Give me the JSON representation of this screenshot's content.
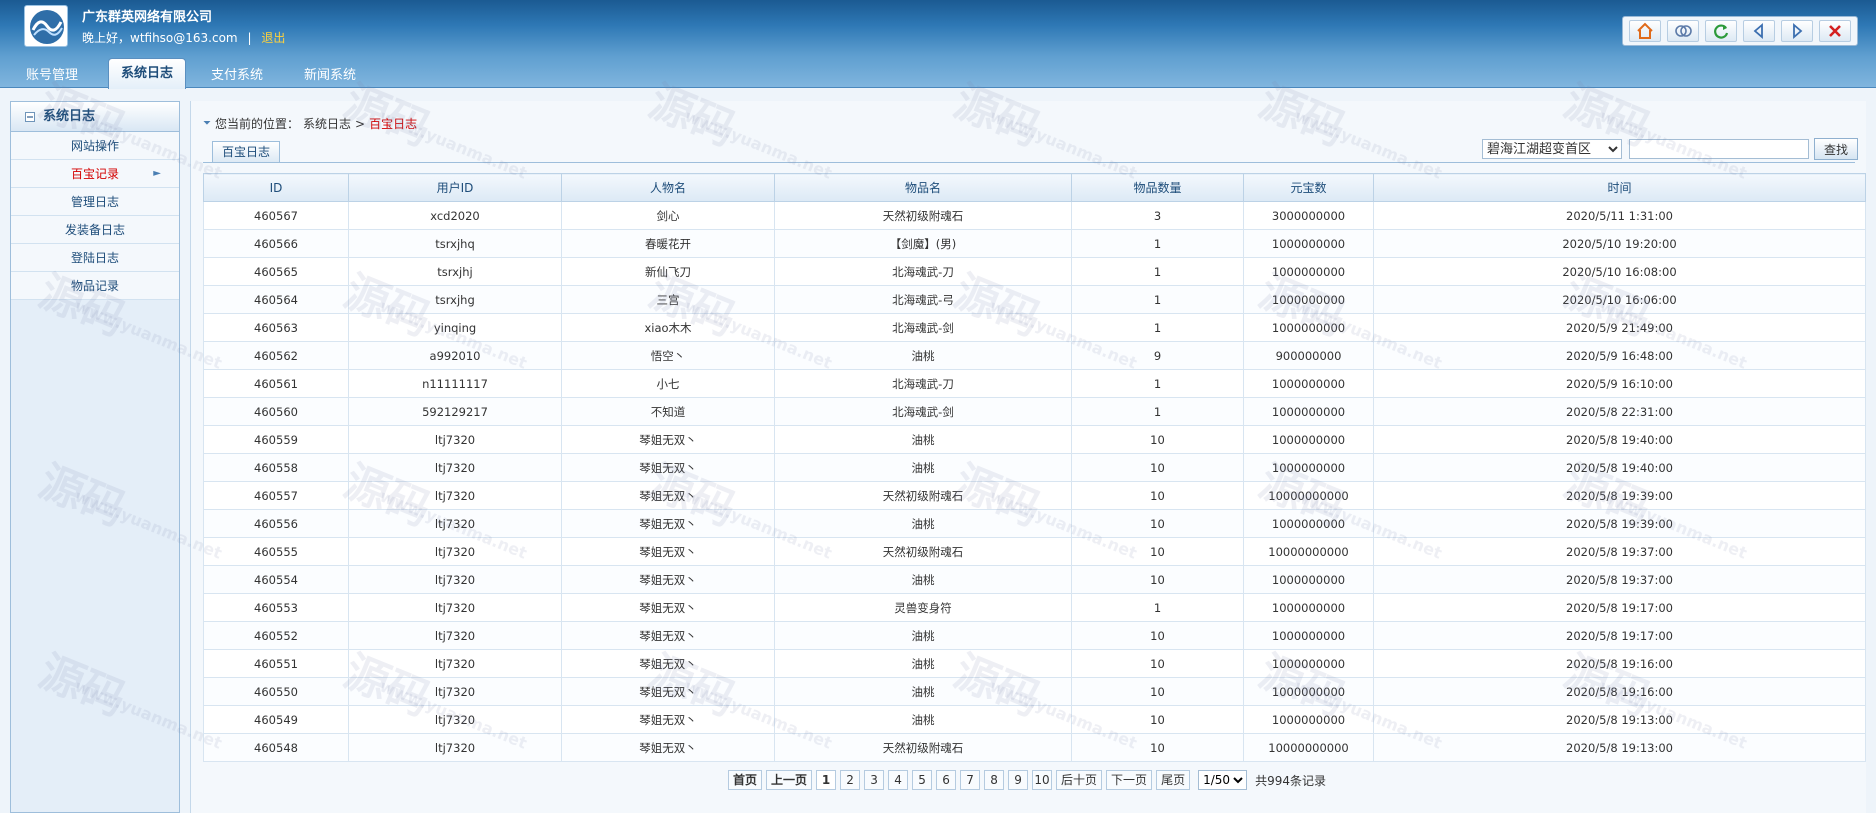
{
  "header": {
    "company": "广东群英网络有限公司",
    "greeting": "晚上好，wtfihso@163.com",
    "separator": "|",
    "logout": "退出"
  },
  "toolbar": [
    {
      "name": "home-icon",
      "color": "#e06a1a"
    },
    {
      "name": "refresh-window-icon",
      "color": "#5c7aa8"
    },
    {
      "name": "reload-icon",
      "color": "#2c9a3a"
    },
    {
      "name": "back-icon",
      "color": "#3c6fb0"
    },
    {
      "name": "forward-icon",
      "color": "#3c6fb0"
    },
    {
      "name": "close-icon",
      "color": "#d42020"
    }
  ],
  "tabs": [
    "账号管理",
    "系统日志",
    "支付系统",
    "新闻系统"
  ],
  "sidebar": {
    "title": "系统日志",
    "items": [
      "网站操作",
      "百宝记录",
      "管理日志",
      "发装备日志",
      "登陆日志",
      "物品记录"
    ]
  },
  "breadcrumb": {
    "prefix": "您当前的位置：",
    "section": "系统日志",
    "arrow": ">",
    "current": "百宝日志"
  },
  "subtab": "百宝日志",
  "filter": {
    "server": "碧海江湖超变首区",
    "search_button": "查找"
  },
  "table": {
    "headers": [
      "ID",
      "用户ID",
      "人物名",
      "物品名",
      "物品数量",
      "元宝数",
      "时间"
    ],
    "rows": [
      [
        "460567",
        "xcd2020",
        "剑心",
        "天然初级附魂石",
        "3",
        "3000000000",
        "2020/5/11 1:31:00"
      ],
      [
        "460566",
        "tsrxjhq",
        "春暖花开",
        "【剑魔】(男)",
        "1",
        "1000000000",
        "2020/5/10 19:20:00"
      ],
      [
        "460565",
        "tsrxjhj",
        "新仙飞刀",
        "北海魂武-刀",
        "1",
        "1000000000",
        "2020/5/10 16:08:00"
      ],
      [
        "460564",
        "tsrxjhg",
        "三宫",
        "北海魂武-弓",
        "1",
        "1000000000",
        "2020/5/10 16:06:00"
      ],
      [
        "460563",
        "yinqing",
        "xiao木木",
        "北海魂武-剑",
        "1",
        "1000000000",
        "2020/5/9 21:49:00"
      ],
      [
        "460562",
        "a992010",
        "悟空丶",
        "油桃",
        "9",
        "900000000",
        "2020/5/9 16:48:00"
      ],
      [
        "460561",
        "n11111117",
        "小七",
        "北海魂武-刀",
        "1",
        "1000000000",
        "2020/5/9 16:10:00"
      ],
      [
        "460560",
        "592129217",
        "不知道",
        "北海魂武-剑",
        "1",
        "1000000000",
        "2020/5/8 22:31:00"
      ],
      [
        "460559",
        "ltj7320",
        "琴姐无双丶",
        "油桃",
        "10",
        "1000000000",
        "2020/5/8 19:40:00"
      ],
      [
        "460558",
        "ltj7320",
        "琴姐无双丶",
        "油桃",
        "10",
        "1000000000",
        "2020/5/8 19:40:00"
      ],
      [
        "460557",
        "ltj7320",
        "琴姐无双丶",
        "天然初级附魂石",
        "10",
        "10000000000",
        "2020/5/8 19:39:00"
      ],
      [
        "460556",
        "ltj7320",
        "琴姐无双丶",
        "油桃",
        "10",
        "1000000000",
        "2020/5/8 19:39:00"
      ],
      [
        "460555",
        "ltj7320",
        "琴姐无双丶",
        "天然初级附魂石",
        "10",
        "10000000000",
        "2020/5/8 19:37:00"
      ],
      [
        "460554",
        "ltj7320",
        "琴姐无双丶",
        "油桃",
        "10",
        "1000000000",
        "2020/5/8 19:37:00"
      ],
      [
        "460553",
        "ltj7320",
        "琴姐无双丶",
        "灵兽变身符",
        "1",
        "1000000000",
        "2020/5/8 19:17:00"
      ],
      [
        "460552",
        "ltj7320",
        "琴姐无双丶",
        "油桃",
        "10",
        "1000000000",
        "2020/5/8 19:17:00"
      ],
      [
        "460551",
        "ltj7320",
        "琴姐无双丶",
        "油桃",
        "10",
        "1000000000",
        "2020/5/8 19:16:00"
      ],
      [
        "460550",
        "ltj7320",
        "琴姐无双丶",
        "油桃",
        "10",
        "1000000000",
        "2020/5/8 19:16:00"
      ],
      [
        "460549",
        "ltj7320",
        "琴姐无双丶",
        "油桃",
        "10",
        "1000000000",
        "2020/5/8 19:13:00"
      ],
      [
        "460548",
        "ltj7320",
        "琴姐无双丶",
        "天然初级附魂石",
        "10",
        "10000000000",
        "2020/5/8 19:13:00"
      ]
    ]
  },
  "pager": {
    "first": "首页",
    "prev": "上一页",
    "pages": [
      "1",
      "2",
      "3",
      "4",
      "5",
      "6",
      "7",
      "8",
      "9",
      "10"
    ],
    "current": "1",
    "next_ten": "后十页",
    "next": "下一页",
    "last": "尾页",
    "page_select": "1/50",
    "total": "共994条记录"
  },
  "watermark": {
    "logo_text": "源码",
    "url_text": "www.yuanma.net"
  }
}
